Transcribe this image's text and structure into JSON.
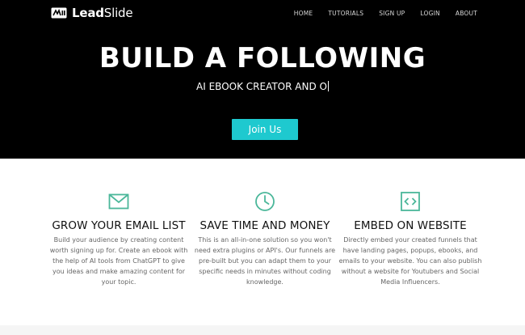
{
  "brand": {
    "name_bold": "Lead",
    "name_light": "Slide"
  },
  "nav": {
    "items": [
      "HOME",
      "TUTORIALS",
      "SIGN UP",
      "LOGIN",
      "ABOUT"
    ]
  },
  "hero": {
    "title": "BUILD A FOLLOWING",
    "typed_text": "AI EBOOK CREATOR AND O",
    "cta_label": "Join Us"
  },
  "features": [
    {
      "icon": "mail-icon",
      "title": "GROW YOUR EMAIL LIST",
      "text": "Build your audience by creating content worth signing up for. Create an ebook with the help of AI tools from ChatGPT to give you ideas and make amazing content for your topic."
    },
    {
      "icon": "clock-icon",
      "title": "SAVE TIME AND MONEY",
      "text": "This is an all-in-one solution so you won't need extra plugins or API's. Our funnels are pre-built but you can adapt them to your specific needs in minutes without coding knowledge."
    },
    {
      "icon": "code-icon",
      "title": "EMBED ON WEBSITE",
      "text": "Directly embed your created funnels that have landing pages, popups, ebooks, and emails to your website. You can also publish without a website for Youtubers and Social Media Influencers."
    }
  ],
  "colors": {
    "accent": "#1ec9cf",
    "icon": "#4bb79a",
    "hero_bg": "#000000"
  }
}
